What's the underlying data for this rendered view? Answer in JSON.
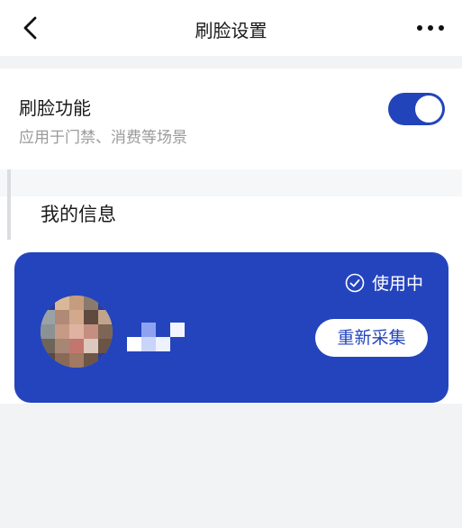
{
  "header": {
    "title": "刷脸设置",
    "back_icon": "chevron-left-icon",
    "more_icon": "more-horizontal-icon"
  },
  "face_toggle": {
    "title": "刷脸功能",
    "subtitle": "应用于门禁、消费等场景",
    "enabled": true
  },
  "my_info": {
    "heading": "我的信息",
    "status_label": "使用中",
    "status_icon": "check-circle-icon",
    "recollect_label": "重新采集"
  },
  "colors": {
    "accent": "#2444be",
    "switch_on": "#2244bb",
    "background": "#f2f3f5"
  }
}
